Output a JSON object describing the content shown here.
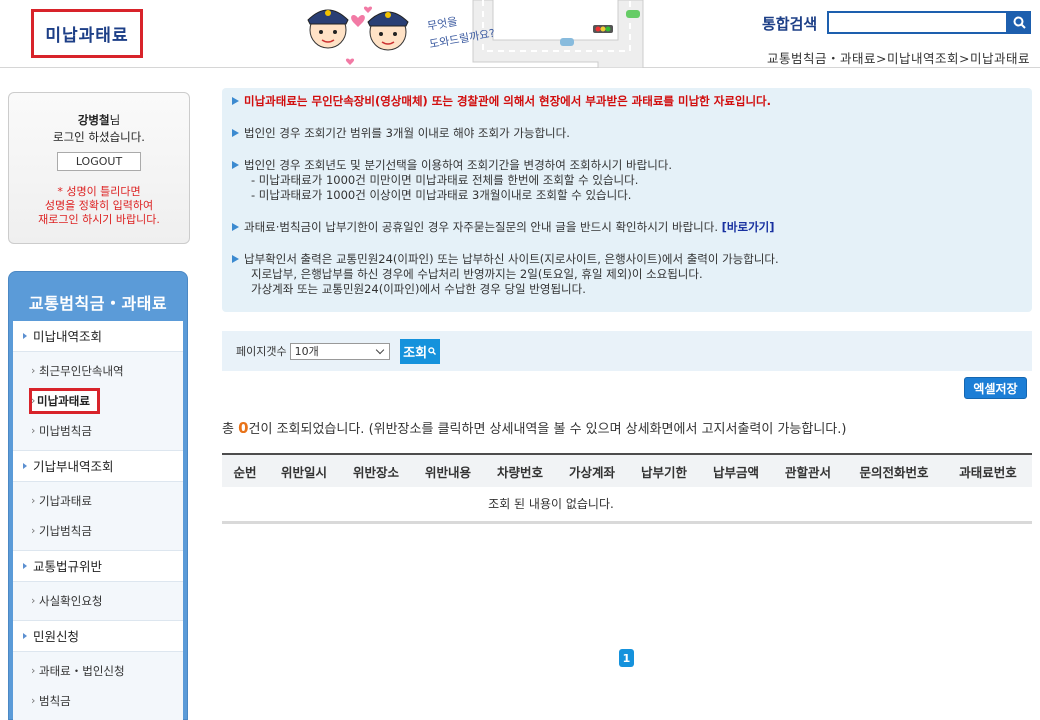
{
  "header": {
    "page_title": "미납과태료",
    "search_label": "통합검색",
    "search_value": "",
    "breadcrumb": "교통범칙금・과태료>미납내역조회>미납과태료",
    "mascot_bubble": "무엇을 도와드릴까요?"
  },
  "login": {
    "user_name": "강병철",
    "name_suffix": "님",
    "logged_in_msg": "로그인 하셨습니다.",
    "logout_label": "LOGOUT",
    "warn_line1": "* 성명이 틀리다면",
    "warn_line2": "성명을 정확히 입력하여",
    "warn_line3": "재로그인 하시기 바랍니다."
  },
  "side_menu": {
    "title": "교통범칙금・과태료",
    "groups": [
      {
        "label": "미납내역조회",
        "items": [
          "최근무인단속내역",
          "미납과태료",
          "미납범칙금"
        ]
      },
      {
        "label": "기납부내역조회",
        "items": [
          "기납과태료",
          "기납범칙금"
        ]
      },
      {
        "label": "교통법규위반",
        "items": [
          "사실확인요청"
        ]
      },
      {
        "label": "민원신청",
        "items": [
          "과태료・법인신청",
          "범칙금"
        ]
      }
    ]
  },
  "info": {
    "line1": "미납과태료는 무인단속장비(영상매체) 또는 경찰관에 의해서 현장에서 부과받은 과태료를 미납한 자료입니다.",
    "line2": "법인인 경우 조회기간 범위를 3개월 이내로 해야 조회가 가능합니다.",
    "line3": "법인인 경우 조회년도 및 분기선택을 이용하여 조회기간을 변경하여 조회하시기 바랍니다.",
    "line3a": "- 미납과태료가 1000건 미만이면 미납과태료 전체를 한번에 조회할 수 있습니다.",
    "line3b": "- 미납과태료가 1000건 이상이면 미납과태료 3개월이내로 조회할 수 있습니다.",
    "line4": "과태료·범칙금이 납부기한이 공휴일인 경우 자주묻는질문의 안내 글을 반드시 확인하시기 바랍니다.",
    "line4_link": "[바로가기]",
    "line5": "납부확인서 출력은 교통민원24(이파인) 또는 납부하신 사이트(지로사이트, 은행사이트)에서 출력이 가능합니다.",
    "line5a": "지로납부, 은행납부를 하신 경우에 수납처리 반영까지는 2일(토요일, 휴일 제외)이 소요됩니다.",
    "line5b": "가상계좌 또는 교통민원24(이파인)에서 수납한 경우 당일 반영됩니다."
  },
  "filter": {
    "label": "페이지갯수",
    "selected": "10개",
    "search_btn": "조회"
  },
  "excel_btn": "엑셀저장",
  "result": {
    "prefix": "총 ",
    "count": "0",
    "suffix": "건이 조회되었습니다. (위반장소를 클릭하면 상세내역을 볼 수 있으며 상세화면에서 고지서출력이 가능합니다.)"
  },
  "table": {
    "headers": [
      "순번",
      "위반일시",
      "위반장소",
      "위반내용",
      "차량번호",
      "가상계좌",
      "납부기한",
      "납부금액",
      "관할관서",
      "문의전화번호",
      "과태료번호"
    ],
    "empty_msg": "조회 된 내용이 없습니다."
  },
  "pagination": {
    "current": "1"
  },
  "colors": {
    "brand": "#1d3f87",
    "accent": "#1592dc",
    "highlight": "#d8232a"
  }
}
